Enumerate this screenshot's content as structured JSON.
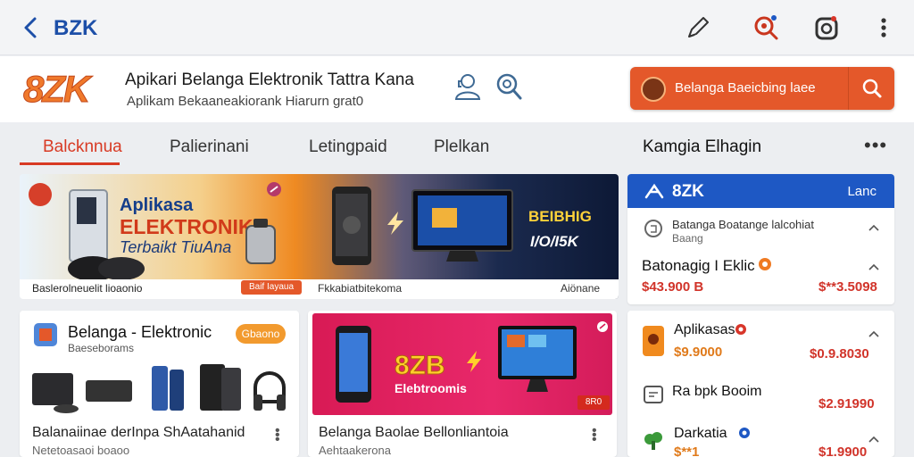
{
  "topbar": {
    "title": "BZK"
  },
  "header": {
    "logo": "8ZK",
    "title": "Apikari Belanga Elektronik Tattra Kana",
    "subtitle": "Aplikam Bekaaneakiorank Hiarurn grat0",
    "search_text": "Belanga Baeicbing laee"
  },
  "tabs": [
    "Balcknnua",
    "Palierinani",
    "Letingpaid",
    "Plelkan"
  ],
  "side_heading": "Kamgia Elhagin",
  "side_more": "•••",
  "banner": {
    "title1": "Aplikasa",
    "title2": "ELEKTRONIK",
    "title3": "Terbaikt TiuAna",
    "side1": "BEIBHIG",
    "side2": "I/O/I5K",
    "caption": "Baslerolneuelit lioaonio",
    "label": "Baif Iayaua",
    "promo": "Fkkabiatbitekoma",
    "tag": "Aiönane"
  },
  "side_card1": {
    "brand": "8ZK",
    "link": "Lanc",
    "item_title": "Batanga Boatange lalcohiat",
    "item_sub": "Baang",
    "product": "Batonagig I Eklic",
    "price_left": "$43.900 B",
    "price_right": "$**3.5098"
  },
  "side_card2": {
    "items": [
      {
        "name": "Aplikasas",
        "price": "$9.9000",
        "price_right": "$0.9.8030"
      },
      {
        "name": "Ra bpk Booim",
        "price": "",
        "price_right": "$2.91990"
      },
      {
        "name": "Darkatia",
        "price": "$**1",
        "price_right": "$1.9900"
      }
    ]
  },
  "product_card1": {
    "title": "Belanga - Elektronic",
    "subtitle": "Baeseborams",
    "badge": "Gbaono",
    "caption": "Balanaiinae derInpa ShAatahanid",
    "caption_sub": "Netetoasaoi boaoo"
  },
  "product_card2": {
    "promo_big": "8ZB",
    "promo_small": "Elebtroomis",
    "promo_tag": "8R0",
    "caption": "Belanga Baolae Bellonliantoia",
    "caption_sub": "Aehtaakerona"
  },
  "colors": {
    "accent": "#e4582a",
    "brand_blue": "#1e58c4",
    "price": "#d1342a",
    "tab_active": "#d83a24"
  }
}
